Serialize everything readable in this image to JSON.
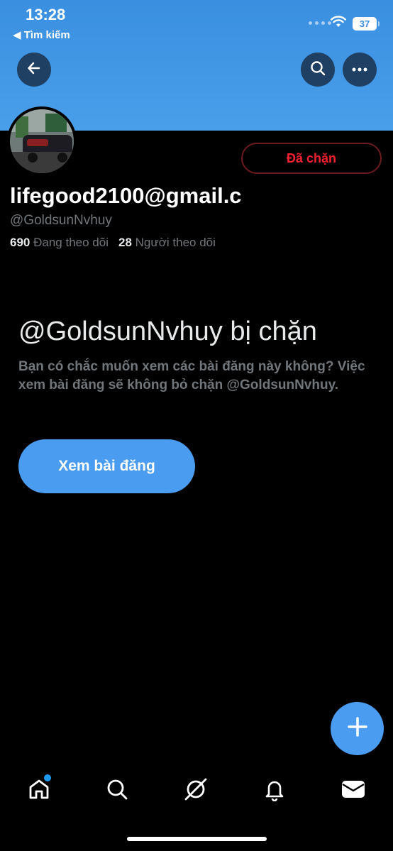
{
  "status_bar": {
    "time": "13:28",
    "back_app": "◀ Tìm kiếm",
    "battery": "37"
  },
  "header": {
    "back_icon": "arrow-left-icon",
    "search_icon": "search-icon",
    "more_icon": "more-horizontal-icon"
  },
  "profile": {
    "display_name": "lifegood2100@gmail.c",
    "handle": "@GoldsunNvhuy",
    "following_count": "690",
    "following_label": "Đang theo dõi",
    "followers_count": "28",
    "followers_label": "Người theo dõi",
    "blocked_button": "Đã chặn"
  },
  "blocked_notice": {
    "title": "@GoldsunNvhuy bị chặn",
    "description": "Bạn có chắc muốn xem các bài đăng này không? Việc xem bài đăng sẽ không bỏ chặn @GoldsunNvhuy.",
    "view_button": "Xem bài đăng"
  },
  "fab_icon": "plus-icon",
  "tabs": [
    {
      "name": "home",
      "icon": "home-icon",
      "has_notification_dot": true
    },
    {
      "name": "search",
      "icon": "search-icon"
    },
    {
      "name": "grok",
      "icon": "grok-icon"
    },
    {
      "name": "notifications",
      "icon": "bell-icon"
    },
    {
      "name": "messages",
      "icon": "mail-icon"
    }
  ],
  "colors": {
    "accent": "#4a9cf0",
    "blocked": "#f4212e",
    "banner": "#3a8fe0"
  }
}
